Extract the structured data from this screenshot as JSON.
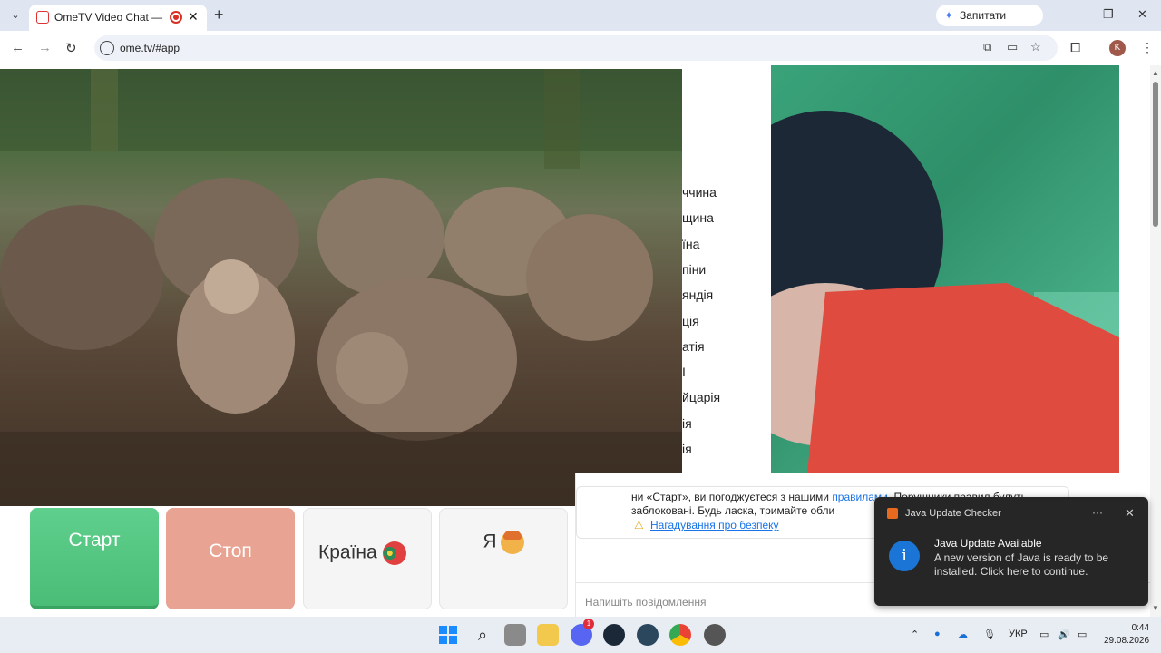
{
  "browser": {
    "tab_title": "OmeTV Video Chat — Ome",
    "tab_close": "✕",
    "new_tab": "+",
    "gemini_label": "Запитати Gemini",
    "url": "ome.tv/#app",
    "avatar_letter": "K"
  },
  "partner": {
    "country_list": [
      "ччина",
      "щина",
      "їна",
      "піни",
      "яндія",
      "ція",
      "атія",
      "І",
      "йцарія",
      "ія",
      "ія"
    ]
  },
  "controls": {
    "start_label": "Старт",
    "stop_label": "Стоп",
    "country_label": "Країна",
    "me_label": "Я",
    "accent": "#5fcf8d",
    "stop_color": "#e8a393"
  },
  "chat": {
    "notice_text_1": "ни «Старт», ви погоджуєтеся з нашими",
    "notice_link": "правилами",
    "notice_text_2": ". Порушники правил будуть заблоковані. Будь ласка, тримайте обли",
    "safety_link": "Нагадування про безпеку",
    "input_placeholder": "Напишіть повідомлення"
  },
  "popup": {
    "app": "Java Update Checker",
    "more": "···",
    "close": "✕",
    "title": "Java Update Available",
    "body": "A new version of Java is ready to be installed. Click here to continue."
  },
  "taskbar": {
    "lang": "УКР",
    "time": "0:44",
    "date": "29.08.2026",
    "discord_badge": "1"
  }
}
